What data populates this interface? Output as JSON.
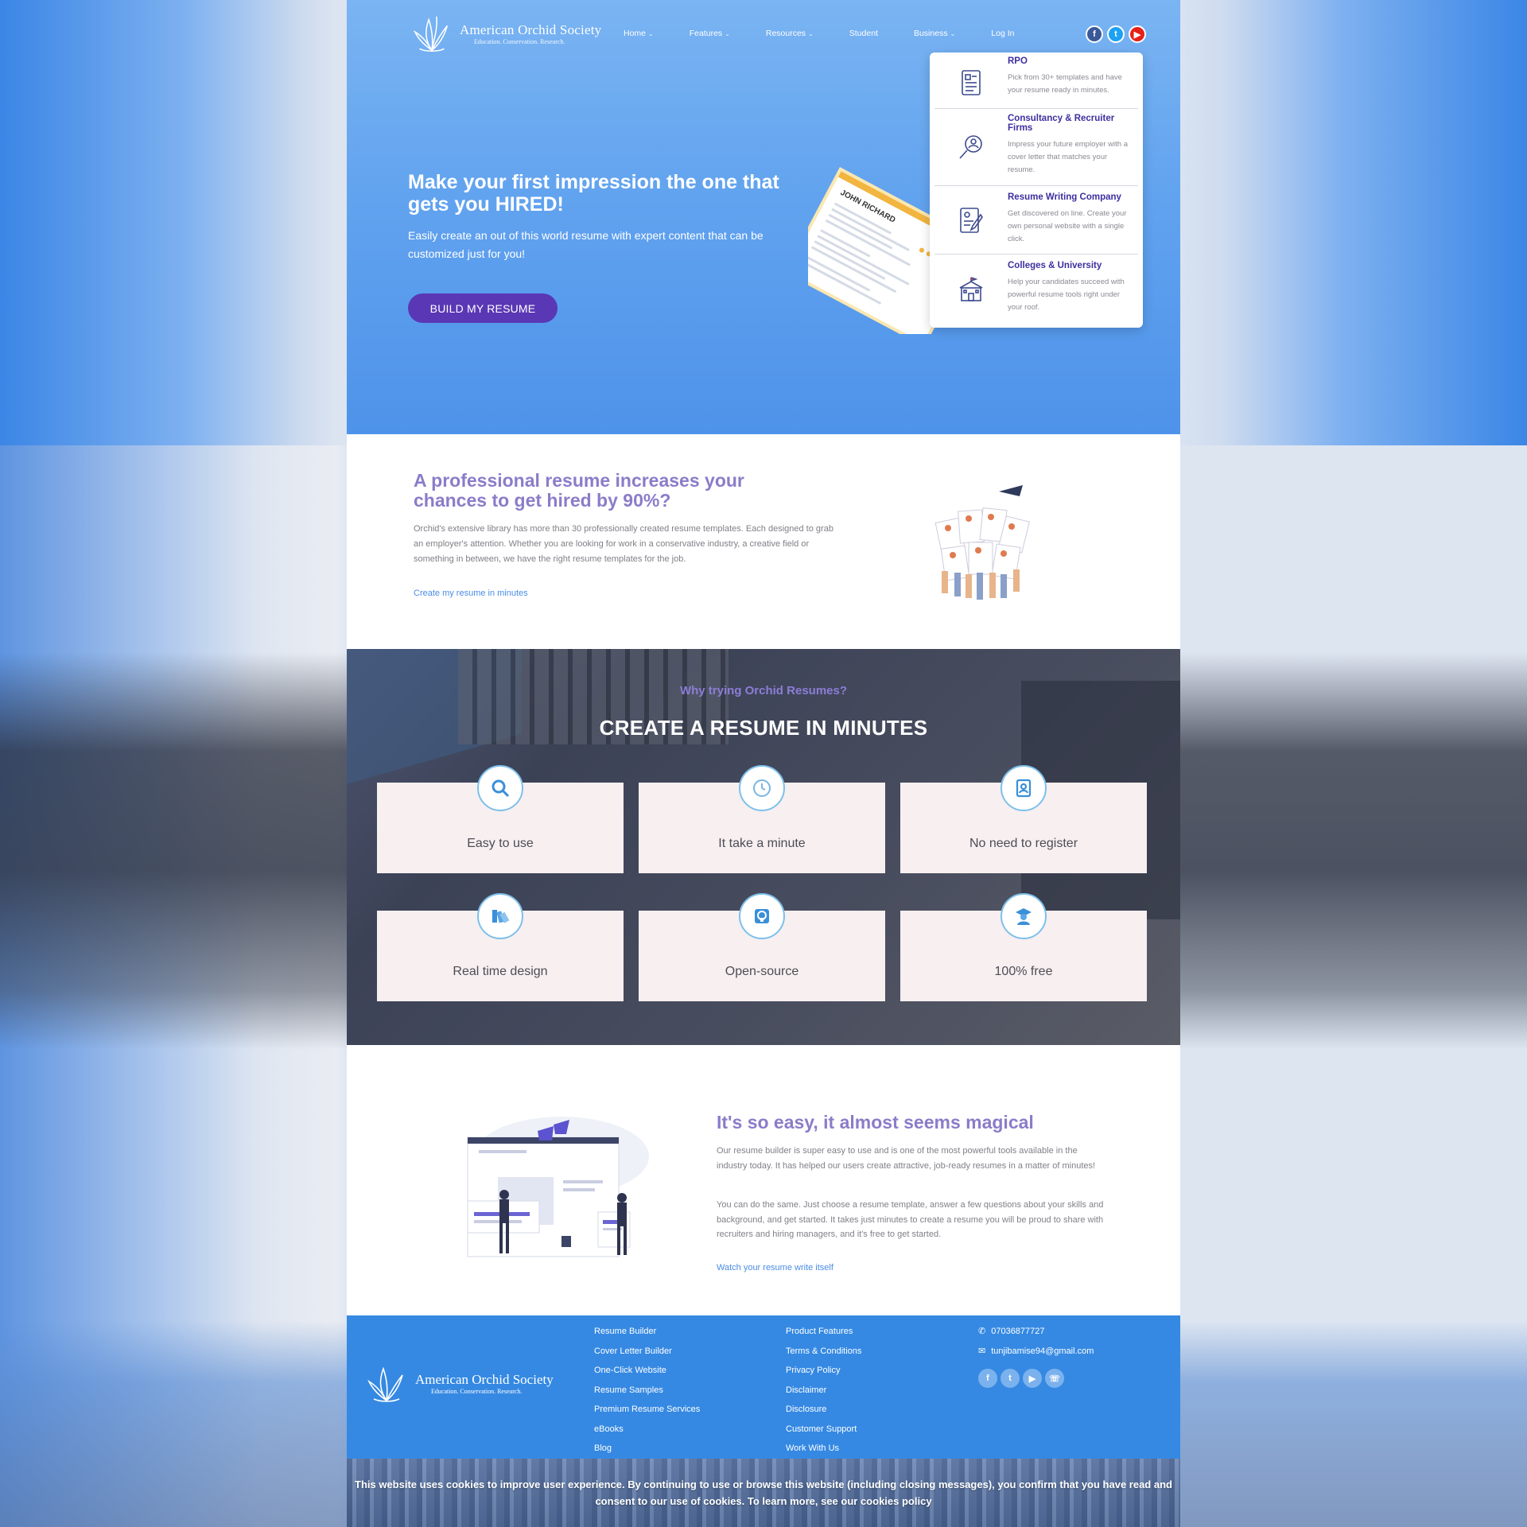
{
  "brand": {
    "name": "American Orchid Society",
    "tagline": "Education. Conservation. Research."
  },
  "nav": {
    "items": [
      {
        "label": "Home",
        "has_menu": true
      },
      {
        "label": "Features",
        "has_menu": true
      },
      {
        "label": "Resources",
        "has_menu": true
      },
      {
        "label": "Student",
        "has_menu": false
      },
      {
        "label": "Business",
        "has_menu": true
      },
      {
        "label": "Log In",
        "has_menu": false
      }
    ]
  },
  "social": [
    "facebook-icon",
    "twitter-icon",
    "youtube-icon"
  ],
  "colors": {
    "accent": "#5a37b5",
    "heading": "#8b7cc9",
    "link": "#4a8ce6",
    "footer": "#3589e3",
    "hero": "#62a3ef"
  },
  "hero": {
    "headline": "Make your first impression the one that gets you HIRED!",
    "subtext": "Easily create an out of this world resume with expert content that can be customized just for you!",
    "cta": "BUILD MY RESUME",
    "resume_name": "JOHN RICHARD"
  },
  "business_menu": [
    {
      "title": "RPO",
      "desc": "Pick from 30+ templates and have your resume ready in minutes.",
      "icon": "document-list-icon"
    },
    {
      "title": "Consultancy & Recruiter Firms",
      "desc": "Impress your future employer with a cover letter that matches your resume.",
      "icon": "search-person-icon"
    },
    {
      "title": "Resume Writing Company",
      "desc": "Get discovered on line. Create your own personal website with a single click.",
      "icon": "resume-edit-icon"
    },
    {
      "title": "Colleges & University",
      "desc": "Help your candidates succeed with powerful resume tools right under your roof.",
      "icon": "school-building-icon"
    }
  ],
  "professional": {
    "heading": "A professional resume increases your chances to get hired by 90%?",
    "body": "Orchid's extensive library has more than 30 professionally created resume templates. Each designed to grab an employer's attention. Whether you are looking for work in a conservative industry, a creative field or something in between, we have the right resume templates for the job.",
    "link": "Create my resume in minutes"
  },
  "why": {
    "eyebrow": "Why trying Orchid Resumes?",
    "title": "CREATE A RESUME IN MINUTES",
    "features": [
      {
        "label": "Easy to use",
        "icon": "search-icon"
      },
      {
        "label": "It take a minute",
        "icon": "clock-icon"
      },
      {
        "label": "No need to register",
        "icon": "contact-card-icon"
      },
      {
        "label": "Real time design",
        "icon": "palette-icon"
      },
      {
        "label": "Open-source",
        "icon": "open-source-icon"
      },
      {
        "label": "100% free",
        "icon": "graduate-icon"
      }
    ]
  },
  "magic": {
    "heading": "It's so easy, it almost seems magical",
    "p1": "Our resume builder is super easy to use and is one of the most powerful tools available in the industry today. It has helped our users create attractive, job-ready resumes in a matter of minutes!",
    "p2": "You can do the same. Just choose a resume template, answer a few questions about your skills and background, and get started. It takes just minutes to create a resume you will be proud to share with recruiters and hiring managers, and it's free to get started.",
    "link": "Watch your resume write itself"
  },
  "footer": {
    "col1": [
      "Resume Builder",
      "Cover Letter Builder",
      "One-Click Website",
      "Resume Samples",
      "Premium Resume Services",
      "eBooks",
      "Blog"
    ],
    "col2": [
      "Product Features",
      "Terms & Conditions",
      "Privacy Policy",
      "Disclaimer",
      "Disclosure",
      "Customer Support",
      "Work With Us"
    ],
    "phone": "07036877727",
    "email": "tunjibamise94@gmail.com",
    "social": [
      "facebook-icon",
      "twitter-icon",
      "youtube-icon",
      "whatsapp-icon"
    ]
  },
  "cookie": {
    "message": "This website uses cookies to improve user experience. By continuing to use or browse this website (including closing messages), you confirm that you have read and consent to our use of cookies. To learn more, see our cookies policy"
  }
}
